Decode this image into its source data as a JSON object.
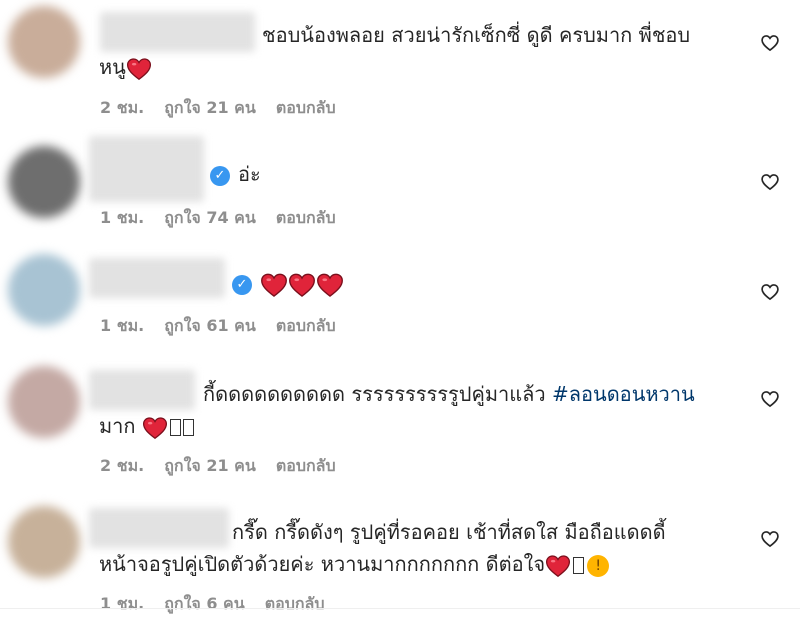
{
  "like_label": "ถูกใจ",
  "people_unit": "คน",
  "reply_label": "ตอบกลับ",
  "comments": [
    {
      "line1": "ชอบน้องพลอย สวยน่ารักเซ็กซี่ ดูดี ครบมาก พี่ชอบ",
      "line2": "หนู",
      "time": "2 ชม.",
      "likes": "21"
    },
    {
      "line1": "อ่ะ",
      "time": "1 ชม.",
      "likes": "74"
    },
    {
      "line1": "",
      "time": "1 ชม.",
      "likes": "61"
    },
    {
      "line1_pre": "กี้ดดดดดดดดดด รรรรรรรรรรูปคู่มาแล้ว ",
      "hashtag": "#ลอนดอนหวาน",
      "line2": "มาก ",
      "time": "2 ชม.",
      "likes": "21"
    },
    {
      "line1": "กรี๊ด กรี๊ดดังๆ รูปคู่ที่รอคอย เช้าที่สดใส มือถือแดดดี้",
      "line2": "หน้าจอรูปคู่เปิดตัวด้วยค่ะ หวานมากกกกกกก ดีต่อใจ",
      "time": "1 ชม.",
      "likes": "6"
    }
  ],
  "colors": {
    "text": "#262626",
    "meta": "#8e8e8e",
    "hashtag": "#00376b",
    "verified": "#3897f0",
    "heart_emoji": "#e0243a"
  },
  "icons": {
    "like_button": "heart-outline-icon",
    "verified": "verified-badge-icon",
    "emoji": "red-heart-emoji"
  }
}
